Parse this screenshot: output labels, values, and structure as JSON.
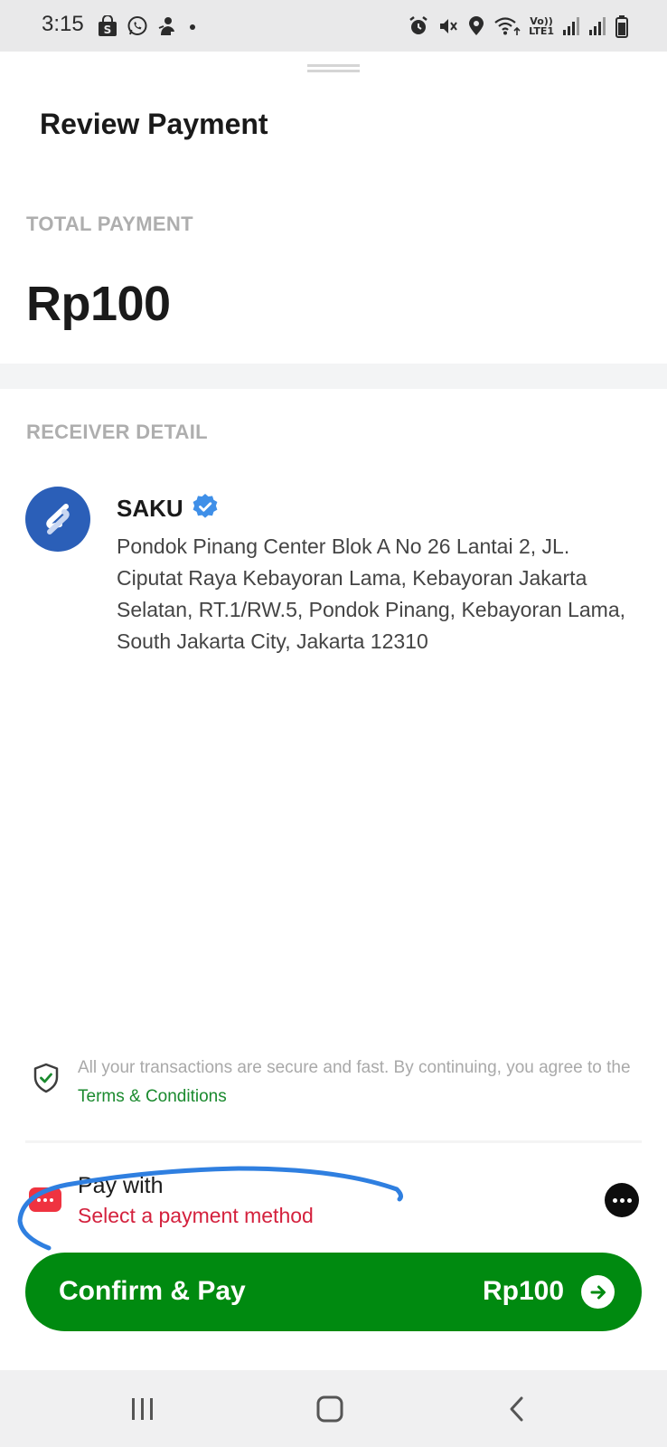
{
  "status_bar": {
    "time": "3:15",
    "left_icons": [
      "shopee-bag-icon",
      "whatsapp-icon",
      "tech-hero-icon",
      "dot-icon"
    ],
    "right_icons": [
      "alarm-icon",
      "mute-vibrate-icon",
      "location-icon",
      "wifi-icon",
      "volte-icon",
      "signal-icon",
      "signal-icon",
      "battery-icon"
    ],
    "volte_text": "Vo))",
    "lte_text": "LTE1"
  },
  "header": {
    "title": "Review Payment"
  },
  "total": {
    "label": "TOTAL PAYMENT",
    "amount": "Rp100"
  },
  "receiver": {
    "label": "RECEIVER DETAIL",
    "name": "SAKU",
    "verified_icon": "verified-badge-icon",
    "logo_color": "#2b5fb8",
    "address": "Pondok Pinang Center Blok A No 26 Lantai 2, JL. Ciputat Raya Kebayoran Lama, Kebayoran Jakarta Selatan, RT.1/RW.5, Pondok Pinang, Kebayoran Lama, South Jakarta City, Jakarta 12310"
  },
  "secure_notice": {
    "text": "All your transactions are secure and fast. By continuing, you agree to the",
    "link_text": "Terms & Conditions",
    "icon": "shield-check-icon"
  },
  "pay_with": {
    "title": "Pay with",
    "subtitle": "Select a payment method",
    "icon": "payment-method-icon",
    "more_icon": "more-options-icon"
  },
  "confirm": {
    "label": "Confirm & Pay",
    "amount": "Rp100",
    "icon": "arrow-right-icon",
    "color": "#008a10"
  },
  "colors": {
    "accent_green": "#008a10",
    "link_green": "#1a8a2e",
    "error_red": "#d4213d",
    "annotation_blue": "#2f7fe0"
  },
  "nav_bar": {
    "icons": [
      "recent-apps-icon",
      "home-icon",
      "back-icon"
    ]
  }
}
